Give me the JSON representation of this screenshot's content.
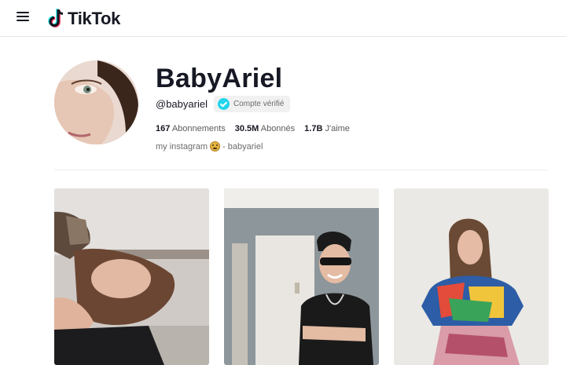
{
  "header": {
    "menu_icon": "hamburger-menu-icon",
    "logo_icon": "tiktok-note-icon",
    "logo_text": "TikTok"
  },
  "profile": {
    "display_name": "BabyAriel",
    "handle": "@babyariel",
    "verified_label": "Compte vérifié",
    "stats": [
      {
        "value": "167",
        "label": "Abonnements"
      },
      {
        "value": "30.5M",
        "label": "Abonnés"
      },
      {
        "value": "1.7B",
        "label": "J'aime"
      }
    ],
    "bio_before": "my instagram",
    "bio_emoji": "smiling-face-emoji",
    "bio_after": "- babyariel"
  },
  "videos": [
    {
      "thumbnail": "girl-on-couch-thumbnail"
    },
    {
      "thumbnail": "boy-with-sunglasses-thumbnail"
    },
    {
      "thumbnail": "girl-in-graphic-tee-thumbnail"
    }
  ],
  "colors": {
    "verified": "#20d5ec",
    "text": "#161823",
    "muted": "#6b6b6b"
  }
}
